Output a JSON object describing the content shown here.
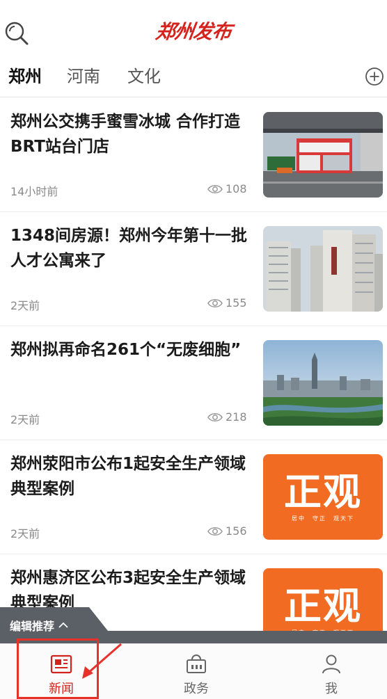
{
  "header": {
    "logo_text": "郑州发布",
    "search_icon": "search-icon"
  },
  "tabs": [
    {
      "label": "郑州",
      "active": true
    },
    {
      "label": "河南",
      "active": false
    },
    {
      "label": "文化",
      "active": false
    }
  ],
  "add_channel_icon": "plus-circle-icon",
  "feed": [
    {
      "title": "郑州公交携手蜜雪冰城 合作打造BRT站台门店",
      "time": "14小时前",
      "views": "108",
      "thumb": "photo-brt-store"
    },
    {
      "title": "1348间房源！郑州今年第十一批人才公寓来了",
      "time": "2天前",
      "views": "155",
      "thumb": "photo-apartments"
    },
    {
      "title": "郑州拟再命名261个“无废细胞”",
      "time": "2天前",
      "views": "218",
      "thumb": "photo-city-skyline"
    },
    {
      "title": "郑州荥阳市公布1起安全生产领域典型案例",
      "time": "2天前",
      "views": "156",
      "thumb": "zhengguan-logo"
    },
    {
      "title": "郑州惠济区公布3起安全生产领域典型案例",
      "time": "",
      "views": "",
      "thumb": "zhengguan-logo"
    }
  ],
  "zhengguan": {
    "big": "正观",
    "small": [
      "居中",
      "守正",
      "观天下"
    ]
  },
  "editor_pick": {
    "label": "编辑推荐"
  },
  "tabbar": [
    {
      "label": "新闻",
      "icon": "news-icon",
      "active": true
    },
    {
      "label": "政务",
      "icon": "government-icon",
      "active": false
    },
    {
      "label": "我",
      "icon": "user-icon",
      "active": false
    }
  ],
  "colors": {
    "brand_red": "#d4231c",
    "zhengguan_orange": "#f26b22"
  }
}
